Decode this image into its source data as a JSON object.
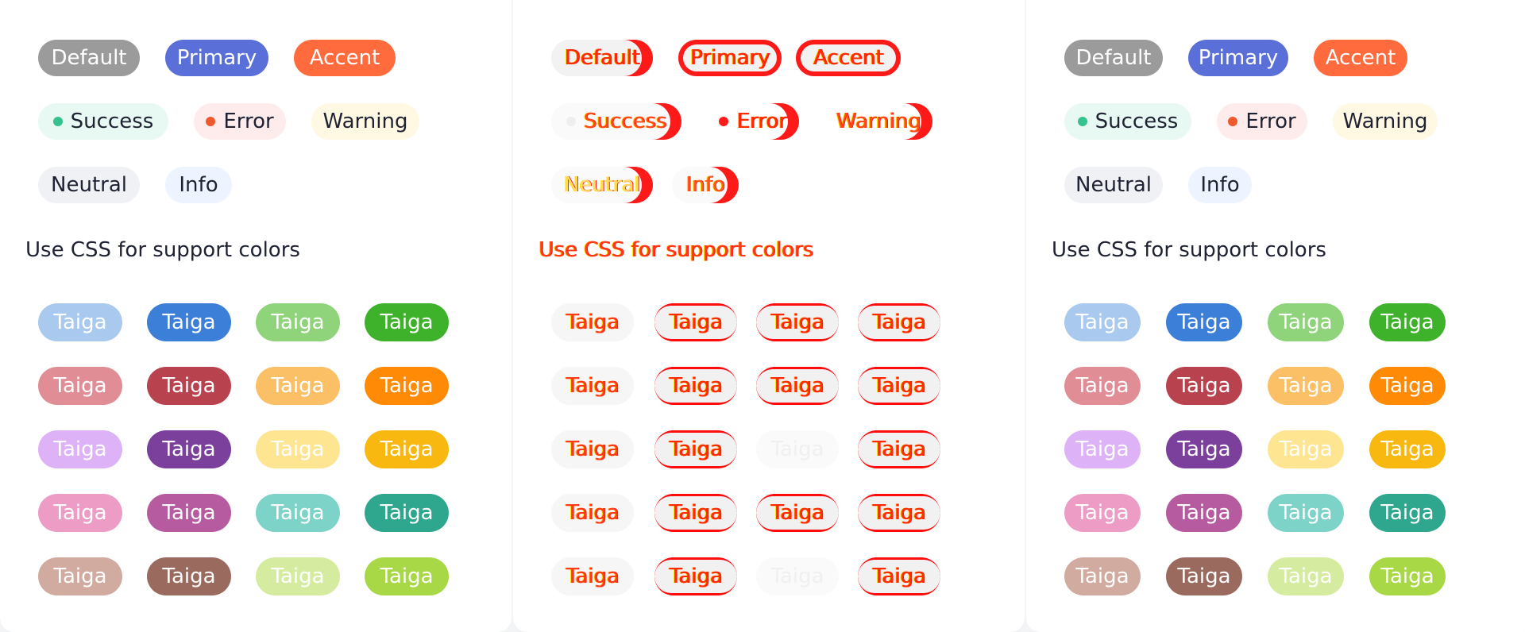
{
  "badges": {
    "default": "Default",
    "primary": "Primary",
    "accent": "Accent",
    "success": "Success",
    "error": "Error",
    "warning": "Warning",
    "neutral": "Neutral",
    "info": "Info"
  },
  "heading": "Use CSS for support colors",
  "tag_label": "Taiga",
  "colors": {
    "default": "#9b9b9b",
    "primary": "#5a6fd8",
    "accent": "#ff6b3d",
    "success_bg": "#e8f8f2",
    "success_dot": "#36c28f",
    "error_bg": "#fdeceb",
    "error_dot": "#f0582e",
    "warning_bg": "#fff8e2",
    "neutral_bg": "#f0f1f4",
    "info_bg": "#edf4ff"
  },
  "tag_rows": [
    [
      "#a9c9ef",
      "#3b7fd8",
      "#8fd47a",
      "#3db22a"
    ],
    [
      "#e18d96",
      "#b8434f",
      "#fbbf66",
      "#ff8a06"
    ],
    [
      "#ddb2f6",
      "#7b3f9c",
      "#fde592",
      "#f9b80f"
    ],
    [
      "#ed9cc6",
      "#b65b9f",
      "#7ed3c9",
      "#2fa68e"
    ],
    [
      "#d1aaa0",
      "#9a6a5e",
      "#d5eca0",
      "#a8d846"
    ]
  ]
}
